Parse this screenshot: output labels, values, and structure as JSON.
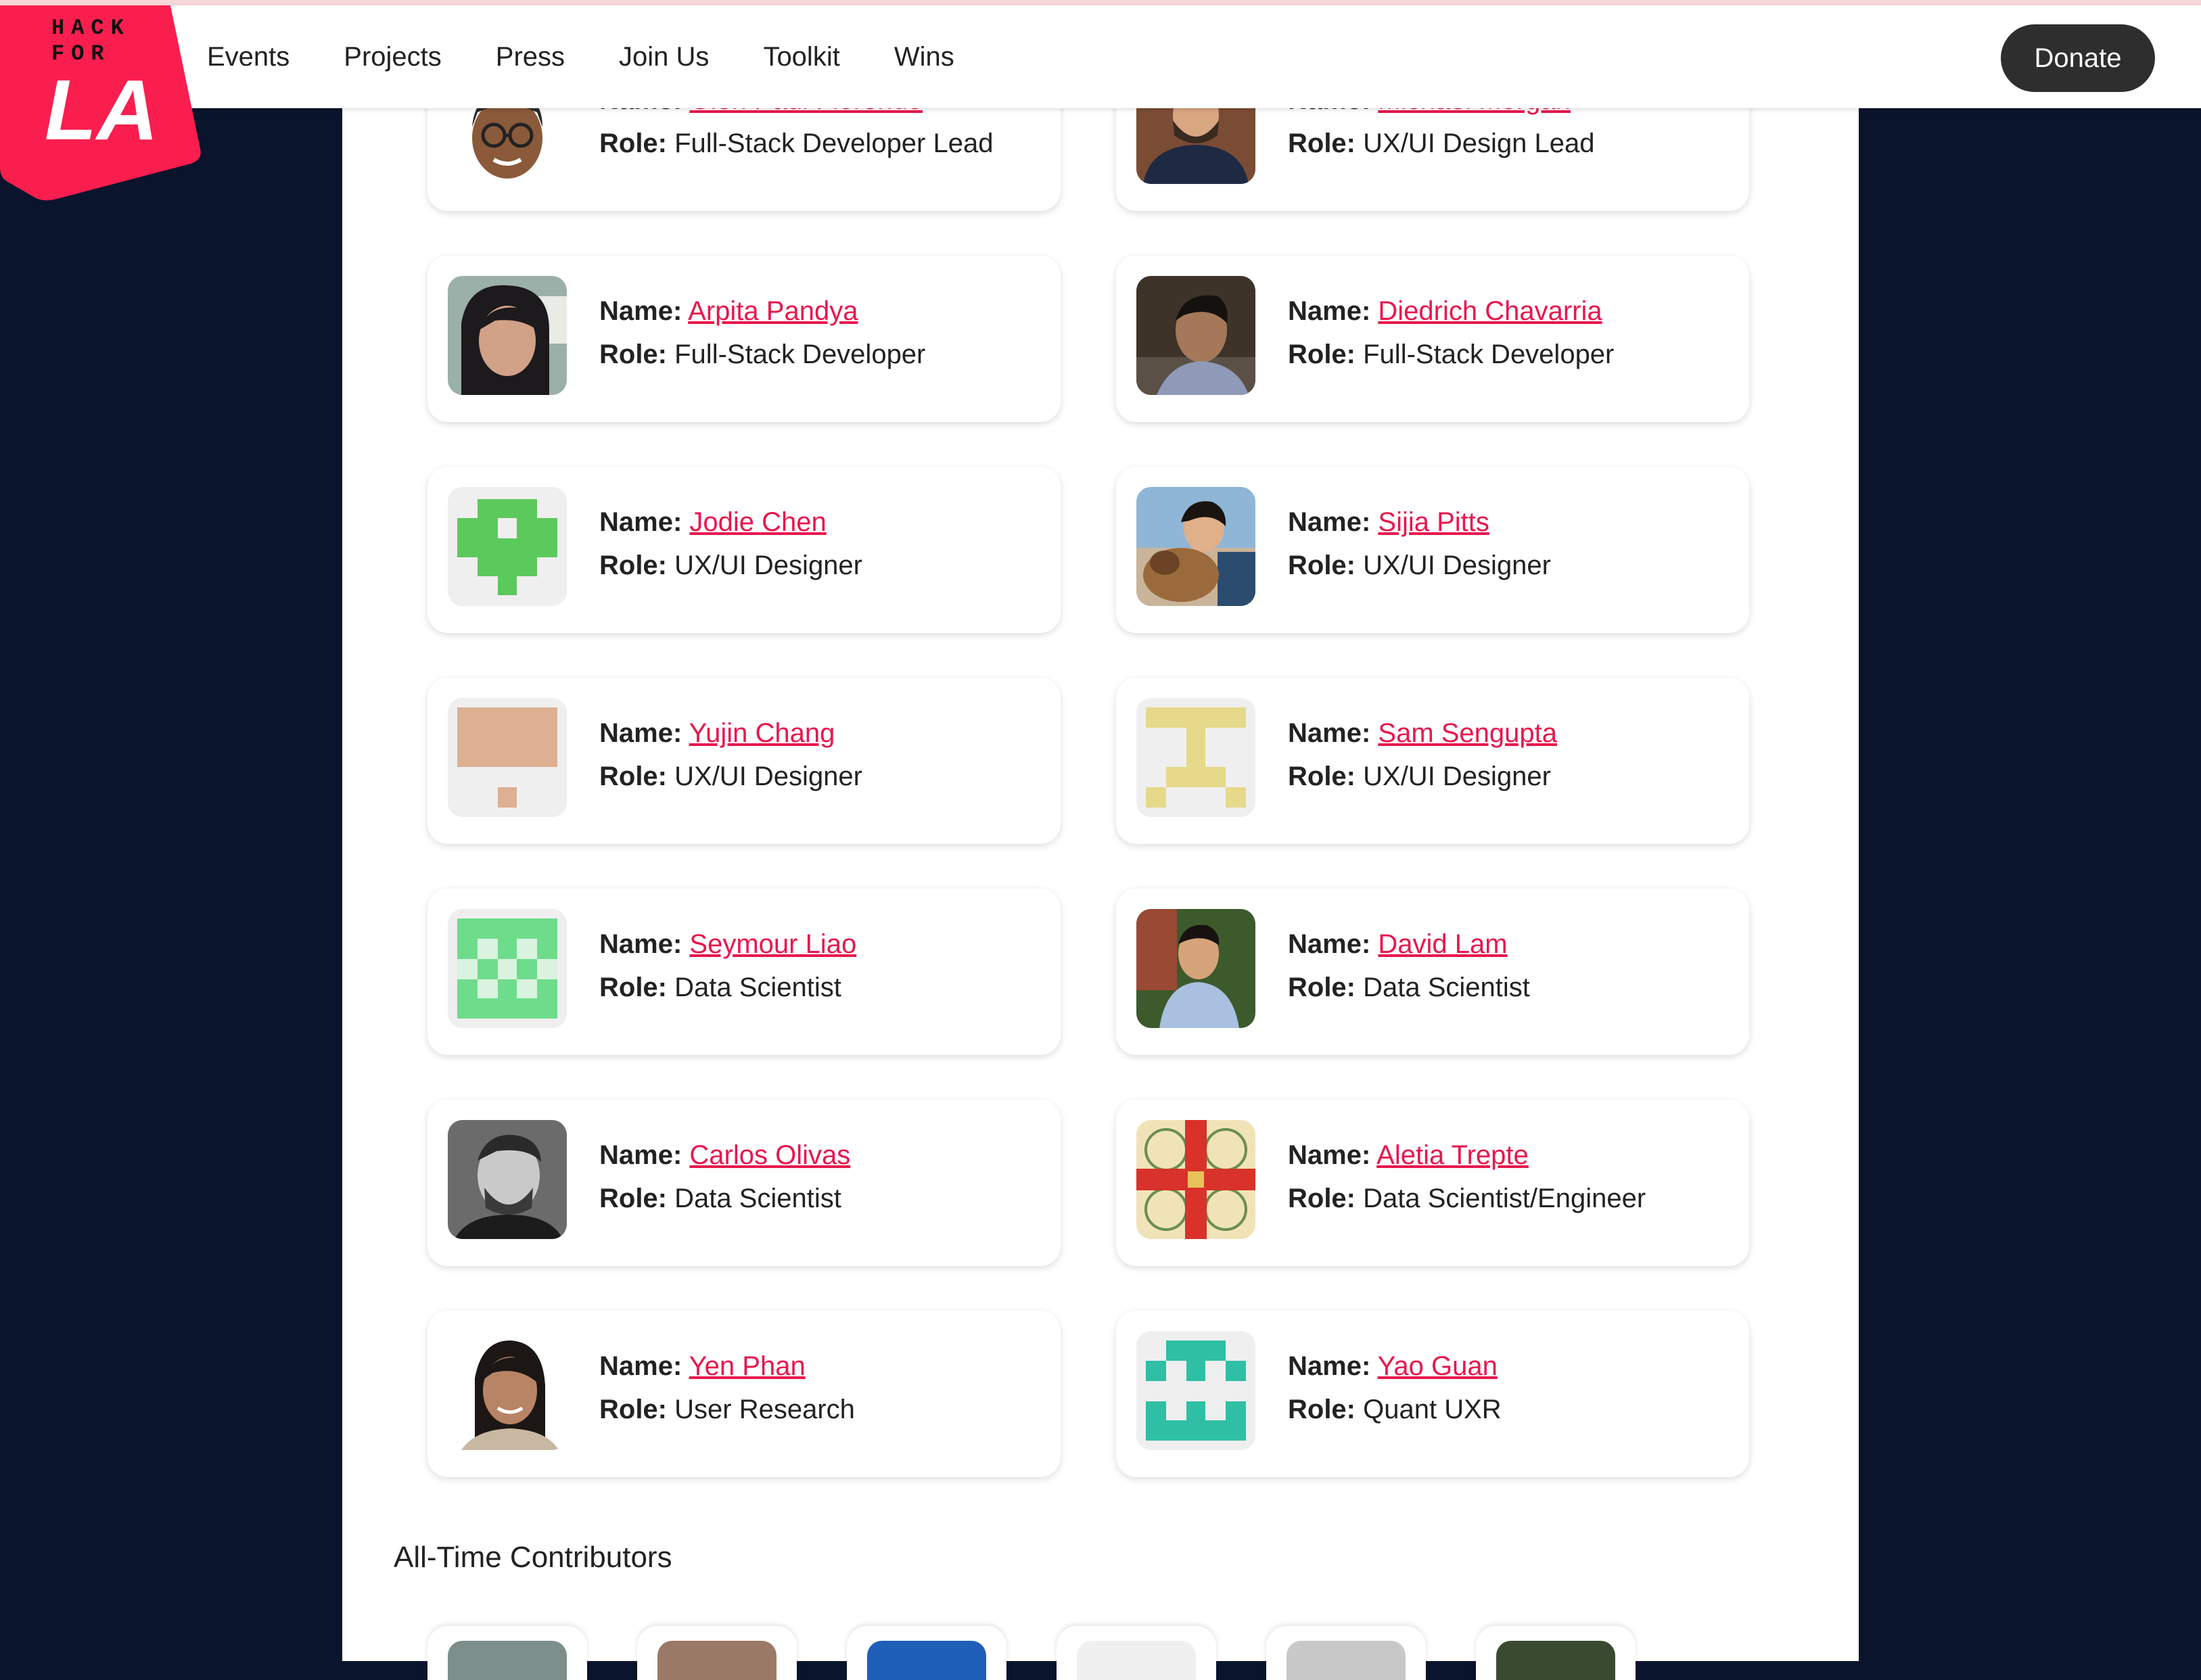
{
  "nav": {
    "logo": {
      "line1": "HACK",
      "line2": "FOR",
      "line3": "LA"
    },
    "links": [
      "Events",
      "Projects",
      "Press",
      "Join Us",
      "Toolkit",
      "Wins"
    ],
    "donate_label": "Donate"
  },
  "labels": {
    "name": "Name:",
    "role": "Role:"
  },
  "team": [
    {
      "name": "Glen Paul Florendo",
      "role": "Full-Stack Developer Lead",
      "avatar": "memoji-photo"
    },
    {
      "name": "Michael Morgan",
      "role": "UX/UI Design Lead",
      "avatar": "photo"
    },
    {
      "name": "Arpita Pandya",
      "role": "Full-Stack Developer",
      "avatar": "photo"
    },
    {
      "name": "Diedrich Chavarria",
      "role": "Full-Stack Developer",
      "avatar": "photo"
    },
    {
      "name": "Jodie Chen",
      "role": "UX/UI Designer",
      "avatar": "identicon",
      "color": "#5cc95c"
    },
    {
      "name": "Sijia Pitts",
      "role": "UX/UI Designer",
      "avatar": "photo"
    },
    {
      "name": "Yujin Chang",
      "role": "UX/UI Designer",
      "avatar": "identicon",
      "color": "#dcb090"
    },
    {
      "name": "Sam Sengupta",
      "role": "UX/UI Designer",
      "avatar": "identicon",
      "color": "#e6d98a"
    },
    {
      "name": "Seymour Liao",
      "role": "Data Scientist",
      "avatar": "identicon",
      "color": "#6fdc8c"
    },
    {
      "name": "David Lam",
      "role": "Data Scientist",
      "avatar": "photo"
    },
    {
      "name": "Carlos Olivas",
      "role": "Data Scientist",
      "avatar": "photo"
    },
    {
      "name": "Aletia Trepte",
      "role": "Data Scientist/Engineer",
      "avatar": "quilt-photo"
    },
    {
      "name": "Yen Phan",
      "role": "User Research",
      "avatar": "photo"
    },
    {
      "name": "Yao Guan",
      "role": "Quant UXR",
      "avatar": "identicon",
      "color": "#2ebfa5"
    }
  ],
  "contributors": {
    "title": "All-Time Contributors"
  },
  "colors": {
    "accent": "#e8174c",
    "page_bg": "#0a142c",
    "donate_bg": "#2e2e2e"
  }
}
